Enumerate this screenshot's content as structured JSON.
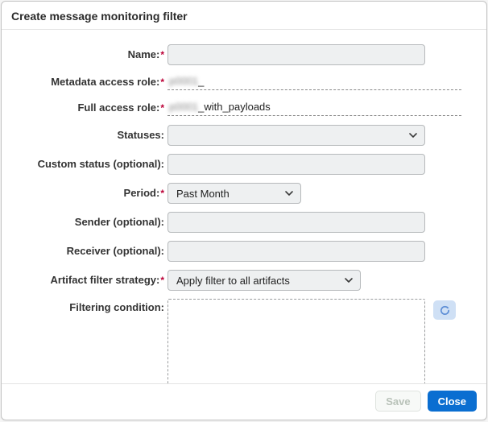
{
  "modal": {
    "title": "Create message monitoring filter"
  },
  "labels": {
    "name": "Name:",
    "metadata_role": "Metadata access role:",
    "full_role": "Full access role:",
    "statuses": "Statuses:",
    "custom_status": "Custom status (optional):",
    "period": "Period:",
    "sender": "Sender (optional):",
    "receiver": "Receiver (optional):",
    "artifact_strategy": "Artifact filter strategy:",
    "filtering_condition": "Filtering condition:"
  },
  "values": {
    "name": "",
    "metadata_role_prefix": "p0001",
    "metadata_role_suffix": "_",
    "full_role_prefix": "p0001",
    "full_role_suffix": "_with_payloads",
    "statuses": "",
    "custom_status": "",
    "period": "Past Month",
    "sender": "",
    "receiver": "",
    "artifact_strategy": "Apply filter to all artifacts",
    "filtering_condition": ""
  },
  "footer": {
    "save": "Save",
    "close": "Close"
  }
}
